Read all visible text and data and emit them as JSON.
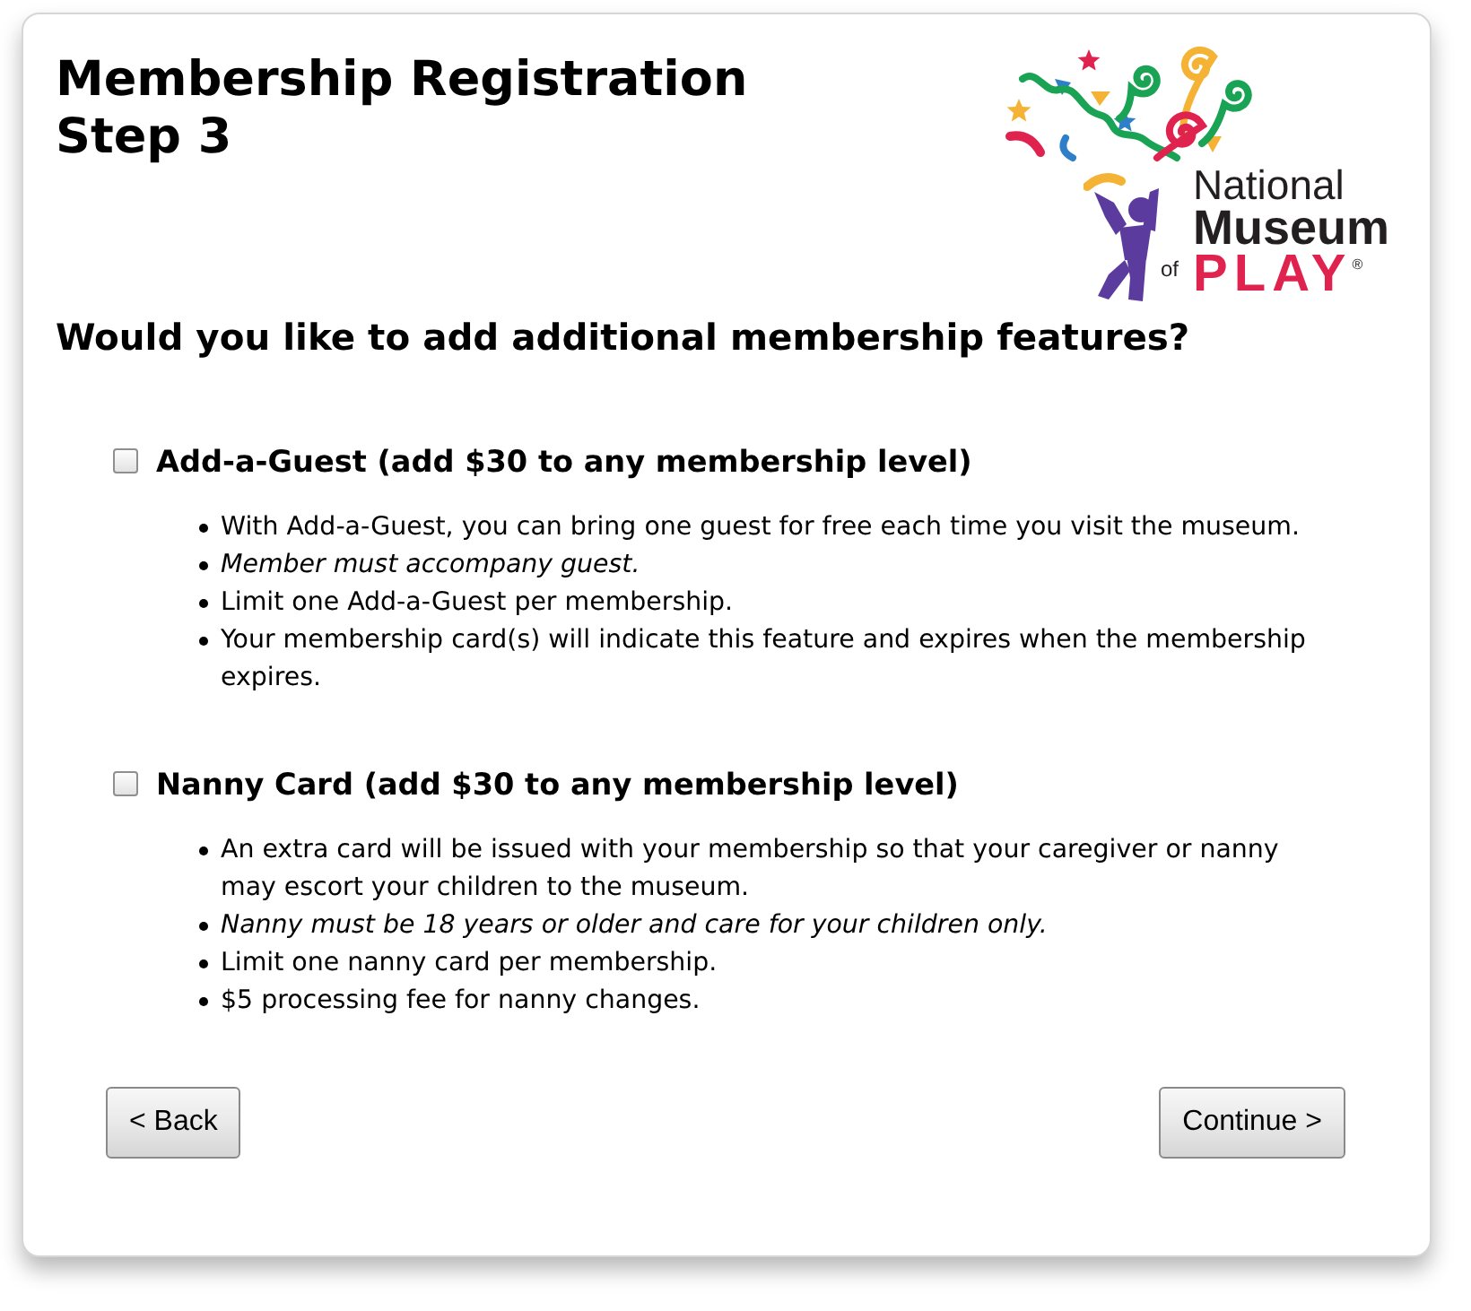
{
  "page": {
    "title": "Membership Registration Step 3"
  },
  "logo": {
    "line_1": "National",
    "line_2": "Museum",
    "line_3": {
      "prefix": "of",
      "word": "PLAY",
      "mark": "®"
    }
  },
  "question": "Would you like to add additional membership features?",
  "options": [
    {
      "label": "Add-a-Guest (add $30 to any membership level)",
      "checked": false,
      "bullets": [
        {
          "kind": "plain",
          "text": "With Add-a-Guest, you can bring one guest for free each time you visit the museum."
        },
        {
          "kind": "note",
          "text": "Member must accompany guest."
        },
        {
          "kind": "plain",
          "text": "Limit one Add-a-Guest per membership."
        },
        {
          "kind": "plain",
          "text": "Your membership card(s) will indicate this feature and expires when the membership expires."
        }
      ]
    },
    {
      "label": "Nanny Card (add $30 to any membership level)",
      "checked": false,
      "bullets": [
        {
          "kind": "plain",
          "text": "An extra card will be issued with your membership so that your caregiver or nanny may escort your children to the museum."
        },
        {
          "kind": "note",
          "text": "Nanny must be 18 years or older and care for your children only."
        },
        {
          "kind": "plain",
          "text": "Limit one nanny card per membership."
        },
        {
          "kind": "plain",
          "text": "$5 processing fee for nanny changes."
        }
      ]
    }
  ],
  "buttons": [
    {
      "kind": "back",
      "label": "< Back"
    },
    {
      "kind": "continue",
      "label": "Continue >"
    }
  ]
}
